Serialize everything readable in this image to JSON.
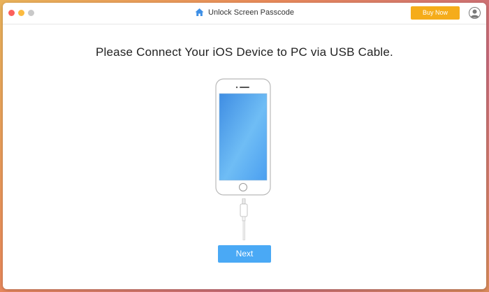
{
  "window": {
    "title": "Unlock Screen Passcode",
    "title_icon": "home-icon",
    "traffic_lights": [
      "close",
      "minimize",
      "zoom"
    ]
  },
  "toolbar": {
    "buy_label": "Buy Now",
    "buy_color": "#f5ac1a",
    "account_icon": "account-icon"
  },
  "main": {
    "heading": "Please Connect Your iOS Device to PC via USB Cable.",
    "illustration": "iphone-with-lightning-cable",
    "next_label": "Next",
    "next_color": "#4aa9f5"
  }
}
